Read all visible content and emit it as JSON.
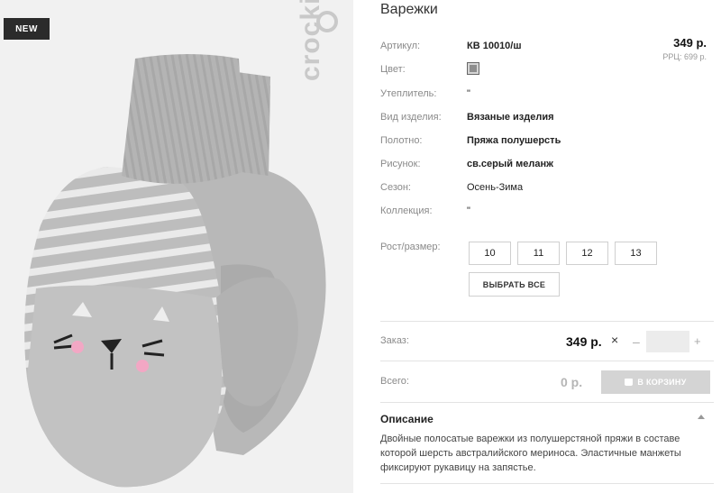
{
  "badge": "NEW",
  "brand": "crockid",
  "product": {
    "title": "Варежки",
    "price": "349 р.",
    "rrp": "РРЦ: 699 р."
  },
  "attributes": [
    {
      "label": "Артикул:",
      "value": "КВ 10010/ш"
    },
    {
      "label": "Цвет:",
      "value": ""
    },
    {
      "label": "Утеплитель:",
      "value": "\""
    },
    {
      "label": "Вид изделия:",
      "value": "Вязаные изделия"
    },
    {
      "label": "Полотно:",
      "value": "Пряжа полушерсть"
    },
    {
      "label": "Рисунок:",
      "value": "св.серый меланж"
    },
    {
      "label": "Сезон:",
      "value": "Осень-Зима"
    },
    {
      "label": "Коллекция:",
      "value": "\""
    }
  ],
  "color_swatch": "#8e8e8e",
  "sizes": {
    "label": "Рост/размер:",
    "options": [
      "10",
      "11",
      "12",
      "13"
    ],
    "select_all": "ВЫБРАТЬ ВСЕ"
  },
  "order": {
    "label": "Заказ:",
    "price": "349 р.",
    "times": "×",
    "minus": "–",
    "plus": "+",
    "quantity": ""
  },
  "total": {
    "label": "Всего:",
    "value": "0 р.",
    "cart_button": "В КОРЗИНУ"
  },
  "description": {
    "heading": "Описание",
    "text": "Двойные полосатые варежки из полушерстяной пряжи в составе которой шерсть австралийского мериноса. Эластичные манжеты фиксируют рукавицу на запястье."
  }
}
